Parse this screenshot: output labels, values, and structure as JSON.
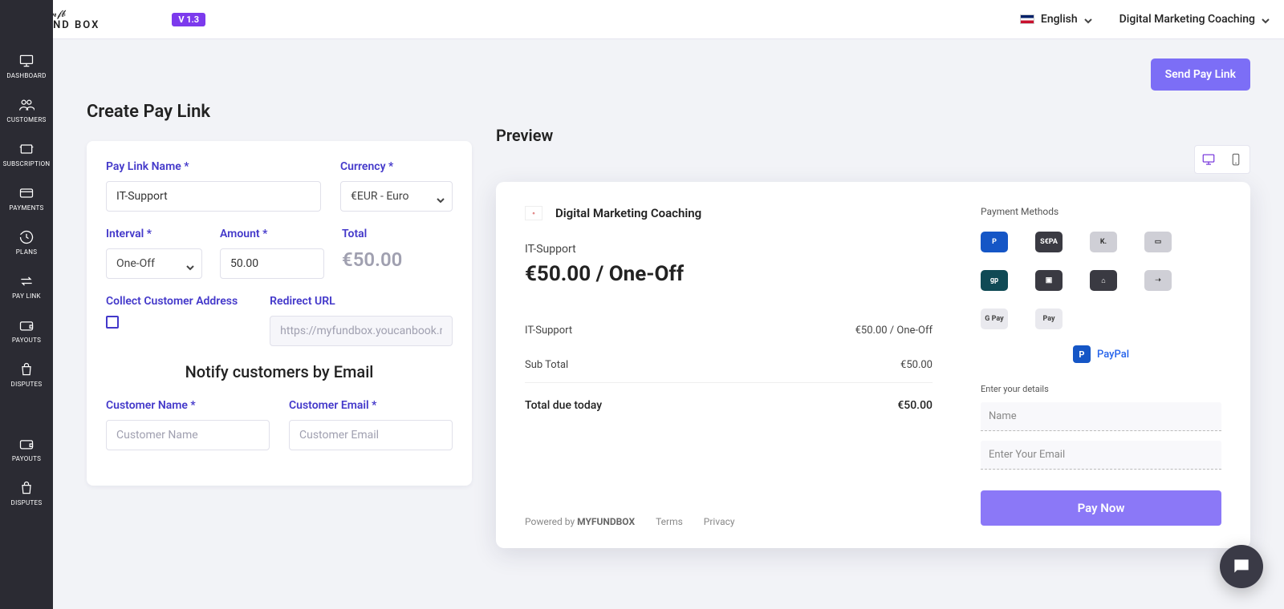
{
  "header": {
    "logo_text": "MY FUND BOX",
    "version": "V 1.3",
    "language": "English",
    "workspace": "Digital Marketing Coaching"
  },
  "sidebar": {
    "items": [
      {
        "icon": "monitor",
        "label": "DASHBOARD"
      },
      {
        "icon": "users",
        "label": "CUSTOMERS"
      },
      {
        "icon": "stack",
        "label": "SUBSCRIPTION"
      },
      {
        "icon": "card",
        "label": "PAYMENTS"
      },
      {
        "icon": "refresh",
        "label": "PLANS"
      },
      {
        "icon": "link",
        "label": "PAY LINK"
      },
      {
        "icon": "wallet",
        "label": "PAYOUTS"
      },
      {
        "icon": "bag",
        "label": "DISPUTES"
      },
      {
        "icon": "wallet",
        "label": "PAYOUTS"
      },
      {
        "icon": "bag",
        "label": "DISPUTES"
      }
    ]
  },
  "actions": {
    "send_pay_link": "Send Pay Link"
  },
  "form": {
    "title": "Create Pay Link",
    "pay_link_name_label": "Pay Link Name *",
    "pay_link_name_value": "IT-Support",
    "currency_label": "Currency *",
    "currency_value": "€EUR - Euro",
    "interval_label": "Interval *",
    "interval_value": "One-Off",
    "amount_label": "Amount *",
    "amount_value": "50.00",
    "total_label": "Total",
    "total_value": "€50.00",
    "collect_address_label": "Collect Customer Address",
    "redirect_label": "Redirect URL",
    "redirect_placeholder": "https://myfundbox.youcanbook.m",
    "notify_heading": "Notify customers by Email",
    "customer_name_label": "Customer Name *",
    "customer_name_placeholder": "Customer Name",
    "customer_email_label": "Customer Email *",
    "customer_email_placeholder": "Customer Email"
  },
  "preview": {
    "title": "Preview",
    "brand": "Digital Marketing Coaching",
    "item": "IT-Support",
    "price_line": "€50.00 / One-Off",
    "row_item_label": "IT-Support",
    "row_item_value": "€50.00 / One-Off",
    "subtotal_label": "Sub Total",
    "subtotal_value": "€50.00",
    "due_label": "Total due today",
    "due_value": "€50.00",
    "powered_prefix": "Powered by ",
    "powered_brand": "MYFUNDBOX",
    "terms": "Terms",
    "privacy": "Privacy",
    "payment_methods_title": "Payment Methods",
    "methods": [
      "PayPal",
      "SEPA",
      "Klarna",
      "Card",
      "giropay",
      "iDEAL",
      "Bancontact",
      "Sofort",
      "Google Pay",
      "Apple Pay"
    ],
    "selected_method": "PayPal",
    "enter_details": "Enter your details",
    "name_placeholder": "Name",
    "email_placeholder": "Enter Your Email",
    "pay_now": "Pay Now"
  }
}
